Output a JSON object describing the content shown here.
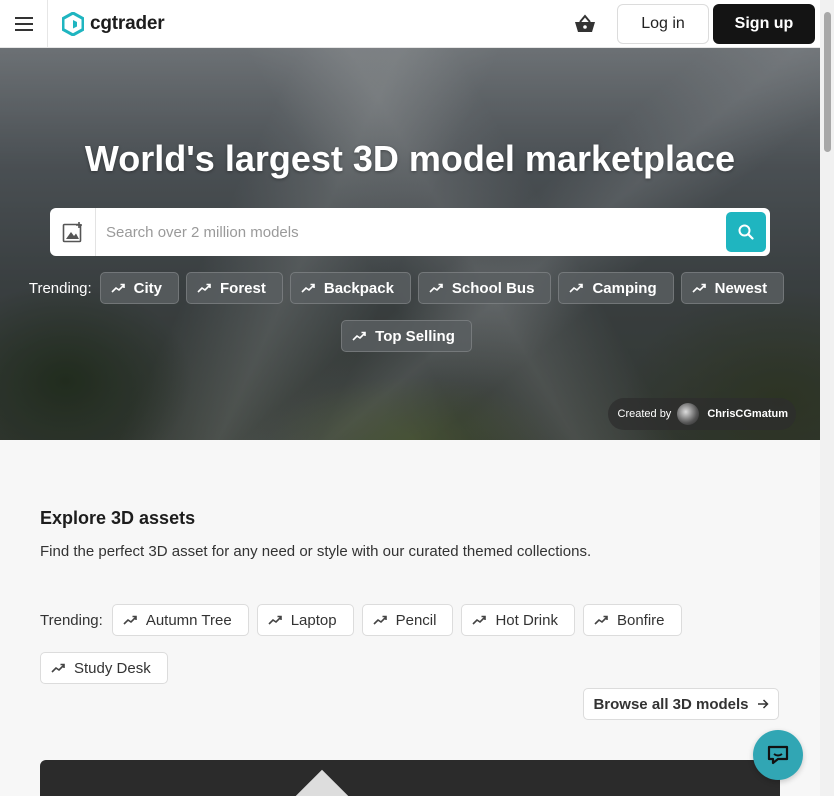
{
  "header": {
    "logo_text": "cgtrader",
    "login_label": "Log in",
    "signup_label": "Sign up"
  },
  "hero": {
    "title": "World's largest 3D model marketplace",
    "search_placeholder": "Search over 2 million models",
    "trending_label": "Trending:",
    "trending": [
      "City",
      "Forest",
      "Backpack",
      "School Bus",
      "Camping",
      "Newest",
      "Top Selling"
    ],
    "credit_prefix": "Created by",
    "credit_author": "ChrisCGmatum"
  },
  "explore": {
    "title": "Explore 3D assets",
    "description": "Find the perfect 3D asset for any need or style with our curated themed collections.",
    "trending_label": "Trending:",
    "trending": [
      "Autumn Tree",
      "Laptop",
      "Pencil",
      "Hot Drink",
      "Bonfire",
      "Study Desk"
    ],
    "browse_label": "Browse all 3D models"
  },
  "colors": {
    "accent": "#1fb5c0",
    "chat": "#31a6b4",
    "signup_bg": "#141414"
  }
}
